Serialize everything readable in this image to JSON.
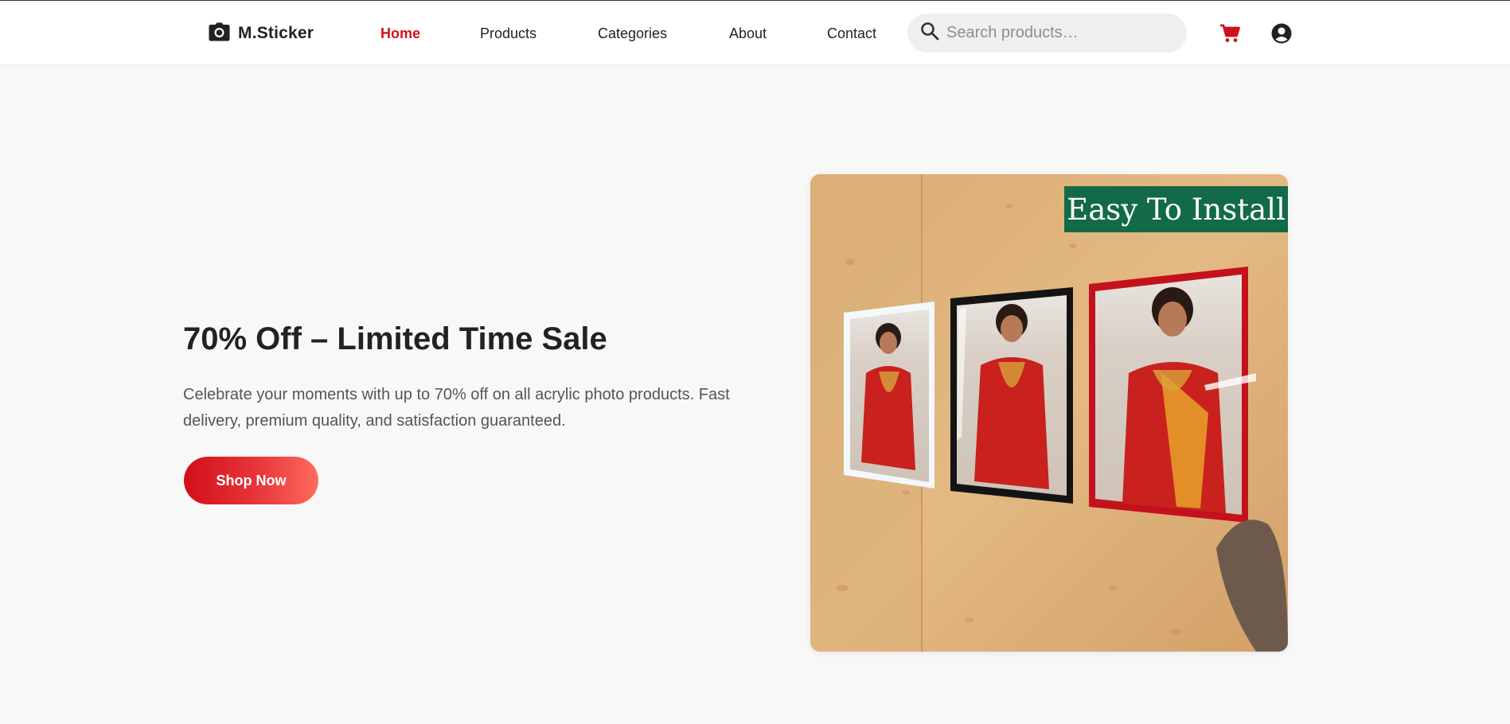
{
  "brand": {
    "name": "M.Sticker",
    "icon": "camera-icon"
  },
  "nav": {
    "home": "Home",
    "products": "Products",
    "categories": "Categories",
    "about": "About",
    "contact": "Contact",
    "active": "Home"
  },
  "search": {
    "placeholder": "Search products…",
    "value": "",
    "icon": "search-icon"
  },
  "actions": {
    "cart_icon": "cart-icon",
    "account_icon": "account-icon"
  },
  "hero": {
    "title": "70% Off – Limited Time Sale",
    "description": "Celebrate your moments with up to 70% off on all acrylic photo products. Fast delivery, premium quality, and satisfaction guaranteed.",
    "cta_label": "Shop Now",
    "image_badge": "Easy To Install"
  },
  "colors": {
    "accent": "#d0111b",
    "badge_green": "#136a47",
    "background": "#f8f8f8"
  }
}
